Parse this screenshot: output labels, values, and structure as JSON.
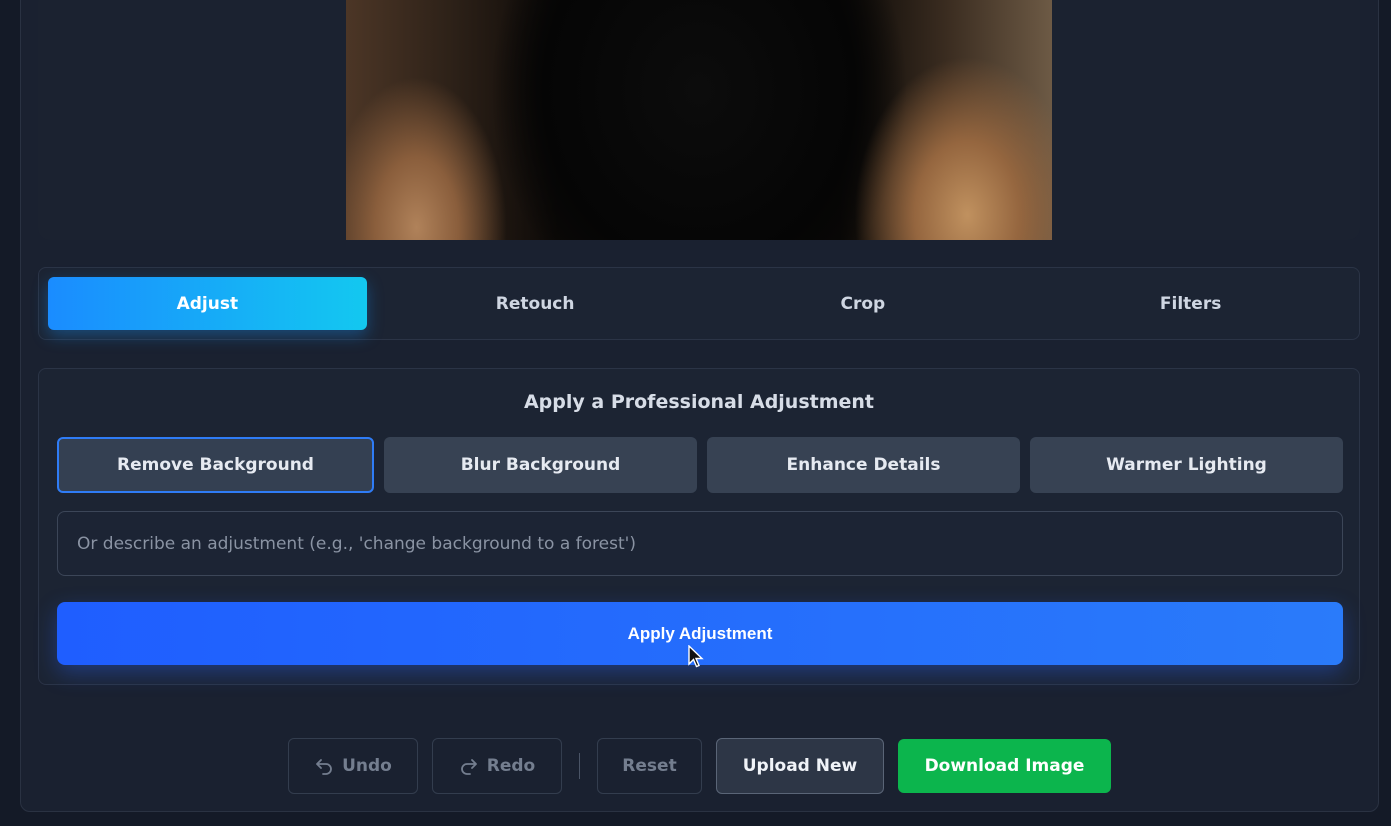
{
  "tabs": [
    {
      "label": "Adjust",
      "active": true
    },
    {
      "label": "Retouch",
      "active": false
    },
    {
      "label": "Crop",
      "active": false
    },
    {
      "label": "Filters",
      "active": false
    }
  ],
  "panel": {
    "title": "Apply a Professional Adjustment",
    "presets": [
      {
        "label": "Remove Background",
        "selected": true
      },
      {
        "label": "Blur Background",
        "selected": false
      },
      {
        "label": "Enhance Details",
        "selected": false
      },
      {
        "label": "Warmer Lighting",
        "selected": false
      }
    ],
    "prompt": {
      "value": "",
      "placeholder": "Or describe an adjustment (e.g., 'change background to a forest')"
    },
    "apply_label": "Apply Adjustment"
  },
  "actions": {
    "undo_label": "Undo",
    "redo_label": "Redo",
    "reset_label": "Reset",
    "upload_label": "Upload New",
    "download_label": "Download Image"
  },
  "colors": {
    "accent": "#1a8cff",
    "apply": "#1f5eff",
    "download": "#0cb54d",
    "background": "#141a27"
  },
  "icons": {
    "undo": "undo-arrow-icon",
    "redo": "redo-arrow-icon",
    "cursor": "mouse-pointer-icon"
  }
}
